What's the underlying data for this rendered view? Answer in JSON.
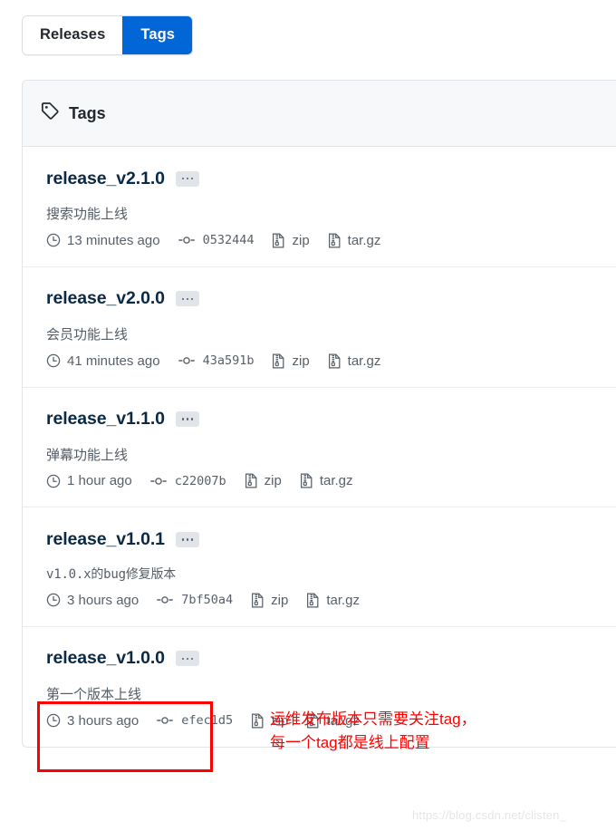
{
  "toggle": {
    "releases_label": "Releases",
    "tags_label": "Tags",
    "active": "Tags",
    "active_color": "#0366d6"
  },
  "card": {
    "header_title": "Tags",
    "header_icon": "tag-icon"
  },
  "tags": [
    {
      "name": "release_v2.1.0",
      "description": "搜索功能上线",
      "description_mono": false,
      "time": "13 minutes ago",
      "commit": "0532444",
      "zip_label": "zip",
      "targz_label": "tar.gz"
    },
    {
      "name": "release_v2.0.0",
      "description": "会员功能上线",
      "description_mono": false,
      "time": "41 minutes ago",
      "commit": "43a591b",
      "zip_label": "zip",
      "targz_label": "tar.gz"
    },
    {
      "name": "release_v1.1.0",
      "description": "弹幕功能上线",
      "description_mono": false,
      "time": "1 hour ago",
      "commit": "c22007b",
      "zip_label": "zip",
      "targz_label": "tar.gz"
    },
    {
      "name": "release_v1.0.1",
      "description": "v1.0.x的bug修复版本",
      "description_mono": true,
      "time": "3 hours ago",
      "commit": "7bf50a4",
      "zip_label": "zip",
      "targz_label": "tar.gz"
    },
    {
      "name": "release_v1.0.0",
      "description": "第一个版本上线",
      "description_mono": false,
      "time": "3 hours ago",
      "commit": "efec1d5",
      "zip_label": "zip",
      "targz_label": "tar.gz"
    }
  ],
  "annotation": {
    "note_text": "运维发布版本只需要关注tag，\n每一个tag都是线上配置",
    "color": "#ff0000"
  },
  "watermark": {
    "text": "https://blog.csdn.net/clisten_"
  }
}
